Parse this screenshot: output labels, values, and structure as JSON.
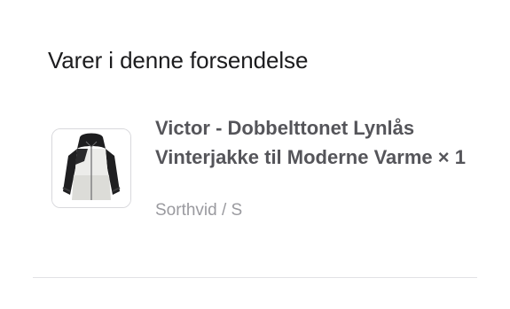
{
  "shipment": {
    "section_title": "Varer i denne forsendelse",
    "items": [
      {
        "title": "Victor - Dobbelttonet Lynlås Vinterjakke til Moderne Varme × 1",
        "variant": "Sorthvid / S",
        "image_icon": "jacket-product-image"
      }
    ]
  },
  "colors": {
    "title_text": "#1c1c1e",
    "item_title_text": "#55555a",
    "variant_text": "#9a9a9f",
    "divider": "#e1e1e5"
  }
}
